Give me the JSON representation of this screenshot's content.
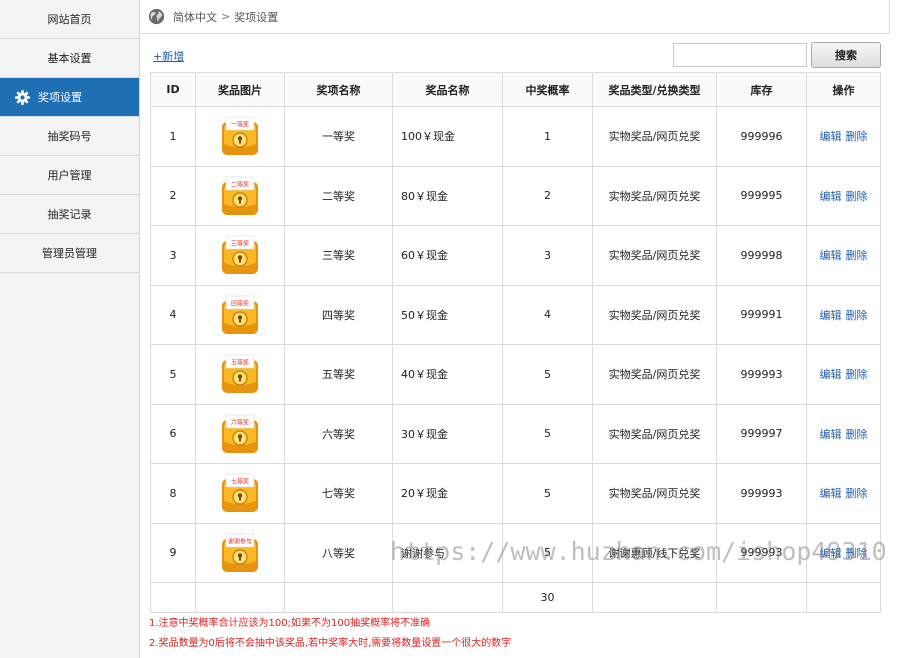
{
  "sidebar": {
    "items": [
      {
        "label": "网站首页"
      },
      {
        "label": "基本设置"
      },
      {
        "label": "奖项设置"
      },
      {
        "label": "抽奖码号"
      },
      {
        "label": "用户管理"
      },
      {
        "label": "抽奖记录"
      },
      {
        "label": "管理员管理"
      }
    ],
    "active_index": 2,
    "active_color": "#1f6fb5"
  },
  "breadcrumb": {
    "lang": "简体中文",
    "separator": ">",
    "page": "奖项设置"
  },
  "toolbar": {
    "add_label": "+新增",
    "search_value": "",
    "search_placeholder": "",
    "search_label": "搜索"
  },
  "table": {
    "headers": [
      "ID",
      "奖品图片",
      "奖项名称",
      "奖品名称",
      "中奖概率",
      "奖品类型/兑换类型",
      "库存",
      "操作"
    ],
    "rows": [
      {
        "id": "1",
        "ribbon": "一等奖",
        "level": "一等奖",
        "prize": "100￥现金",
        "prob": "1",
        "type": "实物奖品/网页兑奖",
        "stock": "999996",
        "edit": "编辑",
        "del": "删除"
      },
      {
        "id": "2",
        "ribbon": "二等奖",
        "level": "二等奖",
        "prize": "80￥现金",
        "prob": "2",
        "type": "实物奖品/网页兑奖",
        "stock": "999995",
        "edit": "编辑",
        "del": "删除"
      },
      {
        "id": "3",
        "ribbon": "三等奖",
        "level": "三等奖",
        "prize": "60￥现金",
        "prob": "3",
        "type": "实物奖品/网页兑奖",
        "stock": "999998",
        "edit": "编辑",
        "del": "删除"
      },
      {
        "id": "4",
        "ribbon": "四等奖",
        "level": "四等奖",
        "prize": "50￥现金",
        "prob": "4",
        "type": "实物奖品/网页兑奖",
        "stock": "999991",
        "edit": "编辑",
        "del": "删除"
      },
      {
        "id": "5",
        "ribbon": "五等奖",
        "level": "五等奖",
        "prize": "40￥现金",
        "prob": "5",
        "type": "实物奖品/网页兑奖",
        "stock": "999993",
        "edit": "编辑",
        "del": "删除"
      },
      {
        "id": "6",
        "ribbon": "六等奖",
        "level": "六等奖",
        "prize": "30￥现金",
        "prob": "5",
        "type": "实物奖品/网页兑奖",
        "stock": "999997",
        "edit": "编辑",
        "del": "删除"
      },
      {
        "id": "8",
        "ribbon": "七等奖",
        "level": "七等奖",
        "prize": "20￥现金",
        "prob": "5",
        "type": "实物奖品/网页兑奖",
        "stock": "999993",
        "edit": "编辑",
        "del": "删除"
      },
      {
        "id": "9",
        "ribbon": "谢谢参与",
        "level": "八等奖",
        "prize": "谢谢参与",
        "prob": "5",
        "type": "谢谢惠顾/线下兑奖",
        "stock": "999993",
        "edit": "编辑",
        "del": "删除"
      }
    ],
    "prob_total": "30",
    "ribbon_color": "#e8261c",
    "box_color": "#f5a81c"
  },
  "notes": [
    "1.注意中奖概率合计应该为100;如果不为100抽奖概率将不准确",
    "2.奖品数量为0后将不会抽中该奖品,若中奖率大时,需要将数量设置一个很大的数字"
  ],
  "notes_color": "#e02020",
  "watermark": "https://www.huzhan.com/ishop49310",
  "icons": {
    "gear": "gear-icon",
    "globe": "globe-icon",
    "prize": "prize-box-icon"
  }
}
